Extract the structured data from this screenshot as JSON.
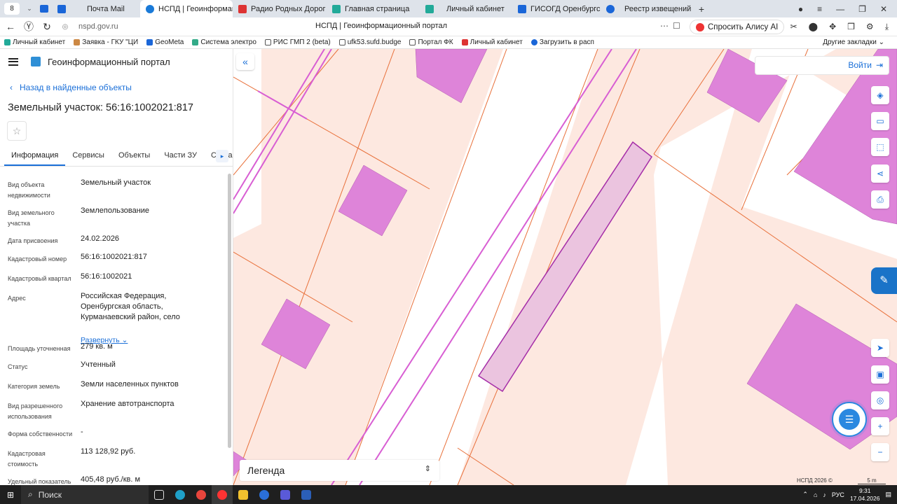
{
  "browser": {
    "profile": "8",
    "tabs": [
      {
        "title": "Почта Mail",
        "color": "#1a66d8"
      },
      {
        "title": "НСПД | Геоинформаци",
        "color": "#1a7ad8",
        "active": true
      },
      {
        "title": "Радио Родных Дорог слу",
        "color": "#d33"
      },
      {
        "title": "Главная страница",
        "color": "#2a9"
      },
      {
        "title": "Личный кабинет",
        "color": "#2a9"
      },
      {
        "title": "ГИСОГД Оренбургской о",
        "color": "#1a66d8"
      },
      {
        "title": "Реестр извещений",
        "color": "#1a66d8"
      }
    ],
    "url": "nspd.gov.ru",
    "page_title": "НСПД | Геоинформационный портал",
    "alisa": "Спросить Алису AI",
    "bookmarks": [
      "Личный кабинет",
      "Заявка - ГКУ \"ЦИ",
      "GeoMeta",
      "Система электро",
      "РИС ГМП 2 (beta)",
      "ufk53.sufd.budge",
      "Портал ФК",
      "Личный кабинет",
      "Загрузить в расп"
    ],
    "other_bookmarks": "Другие закладки"
  },
  "panel": {
    "app_title": "Геоинформационный портал",
    "back_link": "Назад в найденные объекты",
    "object_title": "Земельный участок: 56:16:1002021:817",
    "tabs": [
      "Информация",
      "Сервисы",
      "Объекты",
      "Части ЗУ",
      "Состав"
    ],
    "properties": [
      {
        "label": "Вид объекта недвижимости",
        "value": "Земельный участок"
      },
      {
        "label": "Вид земельного участка",
        "value": "Землепользование"
      },
      {
        "label": "Дата присвоения",
        "value": "24.02.2026"
      },
      {
        "label": "Кадастровый номер",
        "value": "56:16:1002021:817"
      },
      {
        "label": "Кадастровый квартал",
        "value": "56:16:1002021"
      },
      {
        "label": "Адрес",
        "value": "Российская Федерация, Оренбургская область, Курманаевский район, село"
      },
      {
        "label": "Площадь уточненная",
        "value": "279 кв. м"
      },
      {
        "label": "Статус",
        "value": "Учтенный"
      },
      {
        "label": "Категория земель",
        "value": "Земли населенных пунктов"
      },
      {
        "label": "Вид разрешенного использования",
        "value": "Хранение автотранспорта"
      },
      {
        "label": "Форма собственности",
        "value": "-"
      },
      {
        "label": "Кадастровая стоимость",
        "value": "113 128,92 руб."
      },
      {
        "label": "Удельный показатель",
        "value": "405,48 руб./кв. м"
      }
    ],
    "expand_link": "Развернуть"
  },
  "map": {
    "login": "Войти",
    "legend": "Легенда",
    "copyright": "НСПД 2026 ©",
    "scale": "5 m",
    "colors": {
      "parcel_fill": "#fde8e0",
      "parcel_line": "#e8703a",
      "building": "#de84d9",
      "selected": "#ebc4df",
      "selected_line": "#a52da8",
      "road_line": "#d85ed3"
    }
  },
  "taskbar": {
    "search": "Поиск",
    "lang": "РУС",
    "time": "9:31",
    "date": "17.04.2026"
  }
}
